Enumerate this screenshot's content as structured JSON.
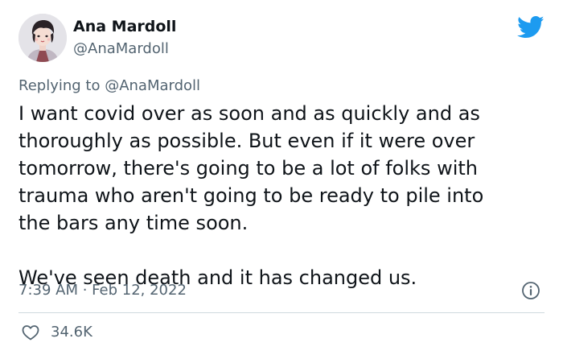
{
  "author": {
    "display_name": "Ana Mardoll",
    "handle": "@AnaMardoll",
    "avatar_icon": "avatar-illustration"
  },
  "reply": {
    "prefix": "Replying to ",
    "handle": "@AnaMardoll"
  },
  "tweet": {
    "text": "I want covid over as soon and as quickly and as\nthoroughly as possible. But even if it were over\ntomorrow, there's going to be a lot of folks with\ntrauma who aren't going to be ready to pile into\nthe bars any time soon.\n\nWe've seen death and it has changed us.",
    "timestamp": "7:39 AM · Feb 12, 2022"
  },
  "stats": {
    "likes": "34.6K"
  },
  "icons": {
    "brand": "twitter-bird-icon",
    "info": "info-icon",
    "like": "heart-icon"
  },
  "colors": {
    "brand": "#1d9bf0",
    "text": "#0f1419",
    "secondary": "#536471",
    "divider": "#cfd9de"
  }
}
